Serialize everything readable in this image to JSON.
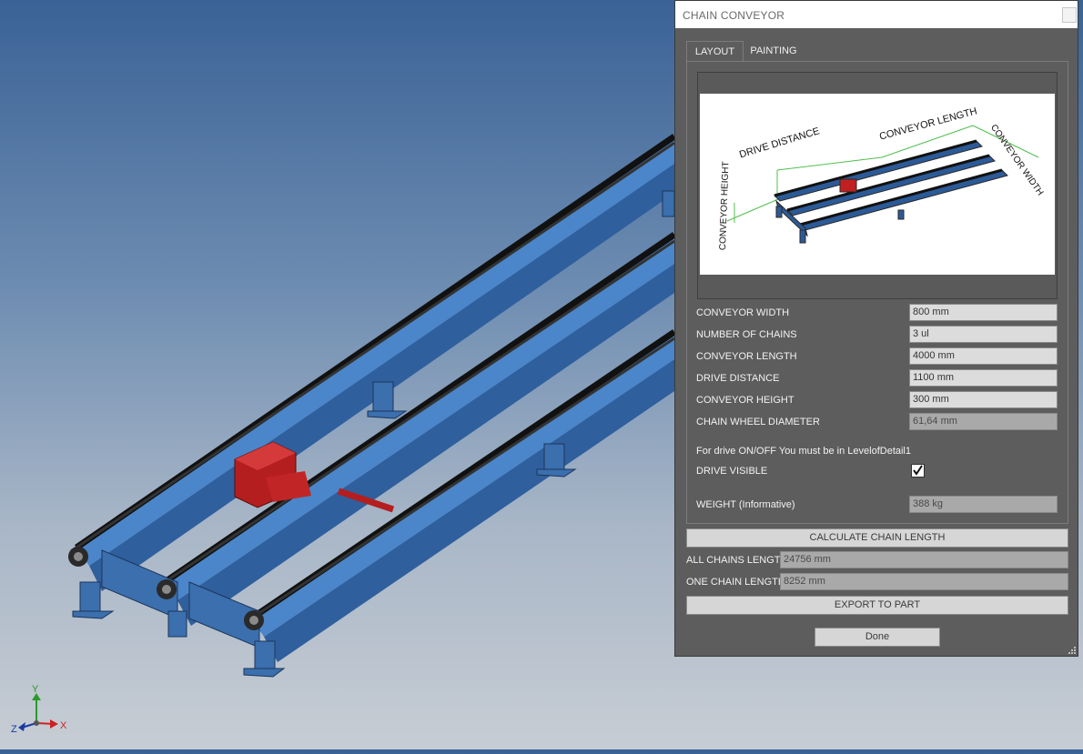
{
  "dialog": {
    "title": "CHAIN CONVEYOR",
    "tabs": [
      {
        "label": "LAYOUT",
        "active": true
      },
      {
        "label": "PAINTING",
        "active": false
      }
    ],
    "preview": {
      "labels": {
        "drive_distance": "DRIVE DISTANCE",
        "conveyor_length": "CONVEYOR LENGTH",
        "conveyor_width": "CONVEYOR WIDTH",
        "conveyor_height": "CONVEYOR HEIGHT"
      }
    },
    "fields": [
      {
        "label": "CONVEYOR WIDTH",
        "value": "800 mm",
        "readonly": false
      },
      {
        "label": "NUMBER OF CHAINS",
        "value": "3 ul",
        "readonly": false
      },
      {
        "label": "CONVEYOR LENGTH",
        "value": "4000 mm",
        "readonly": false
      },
      {
        "label": "DRIVE DISTANCE",
        "value": "1100 mm",
        "readonly": false
      },
      {
        "label": "CONVEYOR HEIGHT",
        "value": "300 mm",
        "readonly": false
      },
      {
        "label": "CHAIN WHEEL DIAMETER",
        "value": "61,64 mm",
        "readonly": true
      }
    ],
    "drive_note": "For drive ON/OFF You must be in LevelofDetail1",
    "drive_visible": {
      "label": "DRIVE VISIBLE",
      "checked": true
    },
    "weight": {
      "label": "WEIGHT (Informative)",
      "value": "388 kg"
    },
    "calculate_button": "CALCULATE CHAIN LENGTH",
    "all_chains": {
      "label": "ALL CHAINS LENGTH",
      "value": "24756 mm"
    },
    "one_chain": {
      "label": "ONE CHAIN LENGTH",
      "value": "8252 mm"
    },
    "export_button": "EXPORT TO PART",
    "done_button": "Done"
  },
  "axis": {
    "x": "X",
    "y": "Y",
    "z": "Z"
  },
  "colors": {
    "frame_blue": "#3a6fb0",
    "drive_red": "#c02020",
    "dialog_bg": "#5d5d5d"
  }
}
